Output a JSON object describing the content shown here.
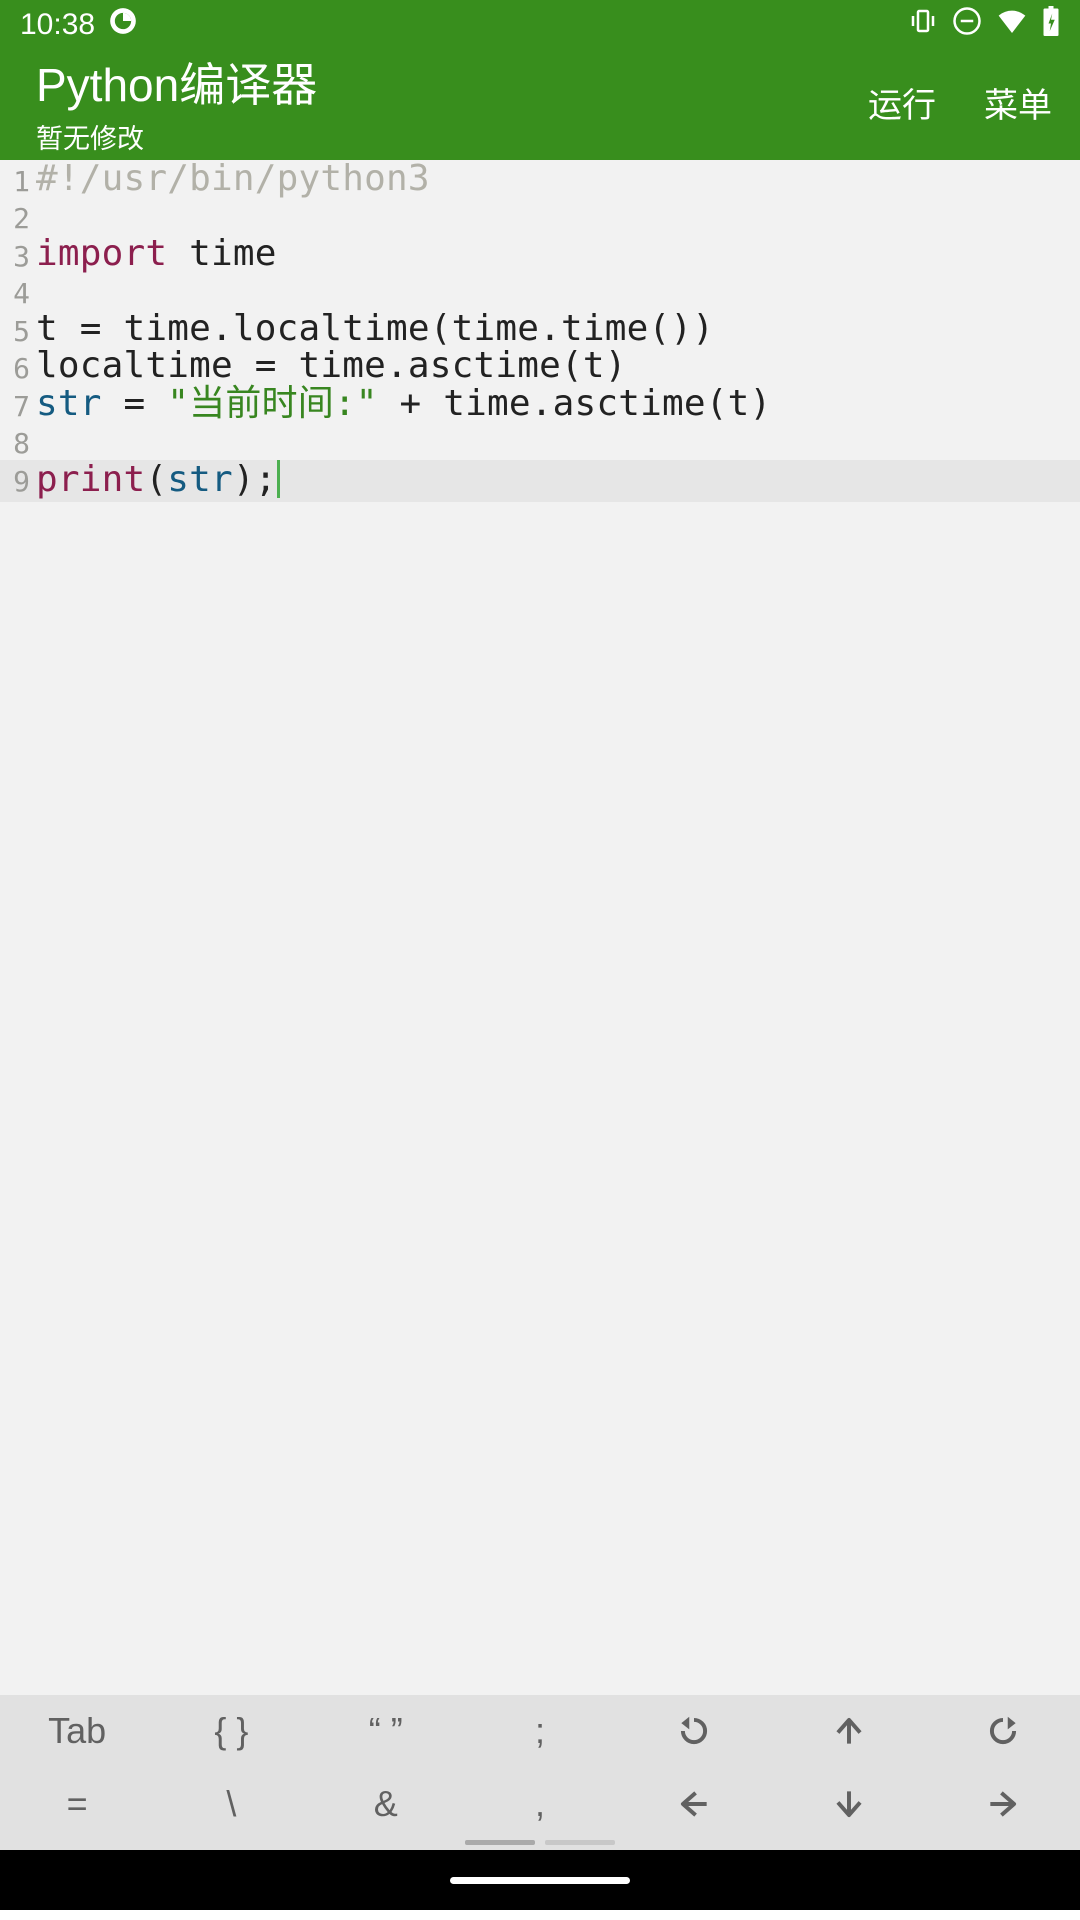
{
  "status": {
    "time": "10:38",
    "icons": [
      "notification-icon",
      "vibrate-icon",
      "dnd-icon",
      "wifi-icon",
      "battery-icon"
    ]
  },
  "appbar": {
    "title": "Python编译器",
    "subtitle": "暂无修改",
    "run_label": "运行",
    "menu_label": "菜单"
  },
  "code": {
    "lines": [
      {
        "n": "1",
        "tokens": [
          {
            "t": "#!/usr/bin/python3",
            "c": "comment"
          }
        ]
      },
      {
        "n": "2",
        "tokens": []
      },
      {
        "n": "3",
        "tokens": [
          {
            "t": "import",
            "c": "keyword"
          },
          {
            "t": " time",
            "c": "default"
          }
        ]
      },
      {
        "n": "4",
        "tokens": []
      },
      {
        "n": "5",
        "tokens": [
          {
            "t": "t = time.localtime(time.time())",
            "c": "default"
          }
        ]
      },
      {
        "n": "6",
        "tokens": [
          {
            "t": "localtime = time.asctime(t)",
            "c": "default"
          }
        ]
      },
      {
        "n": "7",
        "tokens": [
          {
            "t": "str",
            "c": "builtin"
          },
          {
            "t": " = ",
            "c": "default"
          },
          {
            "t": "\"当前时间:\"",
            "c": "string"
          },
          {
            "t": " + time.asctime(t)",
            "c": "default"
          }
        ]
      },
      {
        "n": "8",
        "tokens": []
      },
      {
        "n": "9",
        "tokens": [
          {
            "t": "print",
            "c": "keyword"
          },
          {
            "t": "(",
            "c": "default"
          },
          {
            "t": "str",
            "c": "builtin"
          },
          {
            "t": ");",
            "c": "default"
          }
        ],
        "active": true,
        "cursor": true
      }
    ]
  },
  "toolbar": {
    "row1": [
      "Tab",
      "{ }",
      "“ ”",
      ";",
      "undo-icon",
      "arrow-up-icon",
      "redo-icon"
    ],
    "row2": [
      "=",
      "\\",
      "&",
      ",",
      "arrow-left-icon",
      "arrow-down-icon",
      "arrow-right-icon"
    ]
  }
}
